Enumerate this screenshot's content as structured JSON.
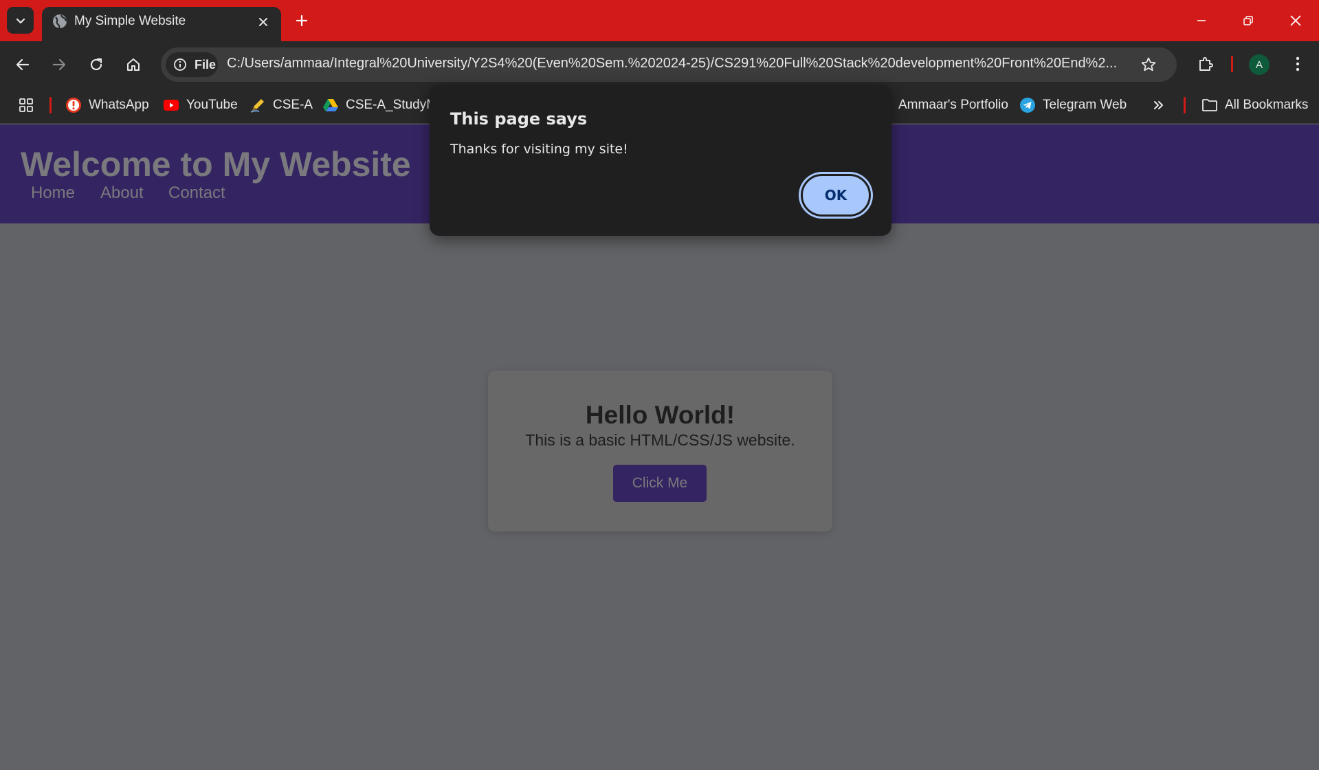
{
  "tab": {
    "title": "My Simple Website",
    "favicon": "globe-icon"
  },
  "toolbar": {
    "chip_label": "File",
    "url": "C:/Users/ammaa/Integral%20University/Y2S4%20(Even%20Sem.%202024-25)/CS291%20Full%20Stack%20development%20Front%20End%2...",
    "profile_initial": "A"
  },
  "bookmarks": {
    "items": [
      {
        "label": "WhatsApp",
        "icon": "whatsapp-icon"
      },
      {
        "label": "YouTube",
        "icon": "youtube-icon"
      },
      {
        "label": "CSE-A",
        "icon": "pen-icon"
      },
      {
        "label": "CSE-A_StudyMa",
        "icon": "google-drive-icon"
      },
      {
        "label": "Ammaar's Portfolio",
        "icon": ""
      },
      {
        "label": "Telegram Web",
        "icon": "telegram-icon"
      }
    ],
    "all_bookmarks": "All Bookmarks"
  },
  "page": {
    "title": "Welcome to My Website",
    "nav": [
      "Home",
      "About",
      "Contact"
    ],
    "card": {
      "heading": "Hello World!",
      "text": "This is a basic HTML/CSS/JS website.",
      "button": "Click Me"
    }
  },
  "dialog": {
    "title": "This page says",
    "message": "Thanks for visiting my site!",
    "ok": "OK"
  },
  "colors": {
    "titlebar": "#d21b18",
    "browser_chrome": "#282828",
    "site_header": "#352462",
    "page_bg": "#626366",
    "ok_button": "#a8c7fa"
  }
}
